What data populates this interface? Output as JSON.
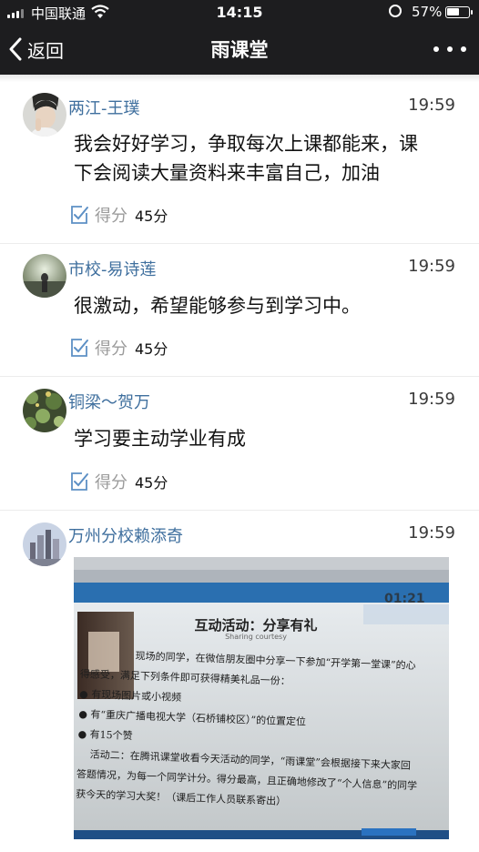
{
  "status_bar": {
    "carrier": "中国联通",
    "time": "14:15",
    "battery": "57%",
    "battery_level": 0.57
  },
  "nav": {
    "back_label": "返回",
    "title": "雨课堂"
  },
  "posts": [
    {
      "author": "两江-王璞",
      "time": "19:59",
      "text_line1": "我会好好学习，争取每次上课都能来，课",
      "text_line2": "下会阅读大量资料来丰富自己，加油",
      "score_label": "得分",
      "score_value": "45分"
    },
    {
      "author": "市校-易诗莲",
      "time": "19:59",
      "text": "很激动，希望能够参与到学习中。",
      "score_label": "得分",
      "score_value": "45分"
    },
    {
      "author": "铜梁～贺万",
      "time": "19:59",
      "text": "学习要主动学业有成",
      "score_label": "得分",
      "score_value": "45分"
    },
    {
      "author": "万州分校赖添奇",
      "time": "19:59",
      "photo": {
        "timer": "01:21",
        "heading": "互动活动：分享有礼",
        "subheading": "Sharing courtesy",
        "line1": "现场的同学，在微信朋友圈中分享一下参加“开学第一堂课”的心",
        "line2": "得感受，满足下列条件即可获得精美礼品一份：",
        "bullet1": "有现场图片或小视频",
        "bullet2": "有“重庆广播电视大学（石桥铺校区）”的位置定位",
        "bullet3": "有15个赞",
        "line3": "活动二：在腾讯课堂收看今天活动的同学，“雨课堂”会根据接下来大家回",
        "line4": "答题情况，为每一个同学计分。得分最高，且正确地修改了“个人信息”的同学",
        "line5": "获今天的学习大奖！（课后工作人员联系寄出）"
      }
    }
  ]
}
